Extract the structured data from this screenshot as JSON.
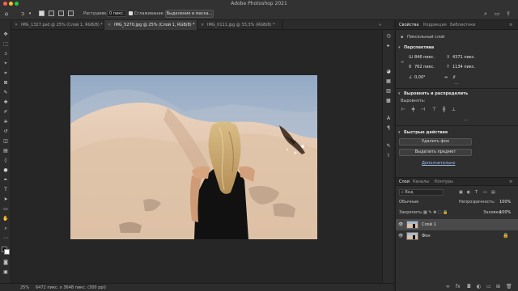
{
  "window": {
    "title": "Adobe Photoshop 2021"
  },
  "options_bar": {
    "feather_label": "Растушевка:",
    "feather_value": "0 пикс.",
    "antialias_label": "Сглаживание",
    "select_mask_button": "Выделение и маска..."
  },
  "tabs": [
    {
      "label": "IMG_1327.psd @ 25% (Слой 1, RGB/8) *",
      "active": false
    },
    {
      "label": "IMG_5270.jpg @ 25% (Слой 1, RGB/8) *",
      "active": true
    },
    {
      "label": "IMG_0111.jpg @ 33,3% (RGB/8) *",
      "active": false
    }
  ],
  "status": {
    "zoom": "25%",
    "doc_info": "6472 пикс. x 3648 пикс. (300 ppi)"
  },
  "properties_panel": {
    "tabs": [
      "Свойства",
      "Коррекция",
      "Библиотеки"
    ],
    "layer_kind": "Пиксельный слой",
    "transform_section": "Перспектива",
    "w_label": "Ш",
    "w_value": "846 пикс.",
    "h_label": "В",
    "h_value": "762 пикс.",
    "x_label": "X",
    "x_value": "4371 пикс.",
    "y_label": "Y",
    "y_value": "1134 пикс.",
    "angle_value": "0,00°",
    "align_section": "Выровнять и распределить",
    "align_label": "Выровнять:",
    "quick_actions_section": "Быстрые действия",
    "remove_bg_button": "Удалить фон",
    "select_subject_button": "Выделить предмет",
    "more_link": "Дополнительно"
  },
  "layers_panel": {
    "tabs": [
      "Слои",
      "Каналы",
      "Контуры"
    ],
    "filter_kind": "Вид",
    "blend_mode": "Обычные",
    "opacity_label": "Непрозрачность:",
    "opacity_value": "100%",
    "lock_label": "Закрепить:",
    "fill_label": "Заливка:",
    "fill_value": "100%",
    "layers": [
      {
        "name": "Слой 1",
        "selected": true,
        "locked": false
      },
      {
        "name": "Фон",
        "selected": false,
        "locked": true
      }
    ]
  }
}
